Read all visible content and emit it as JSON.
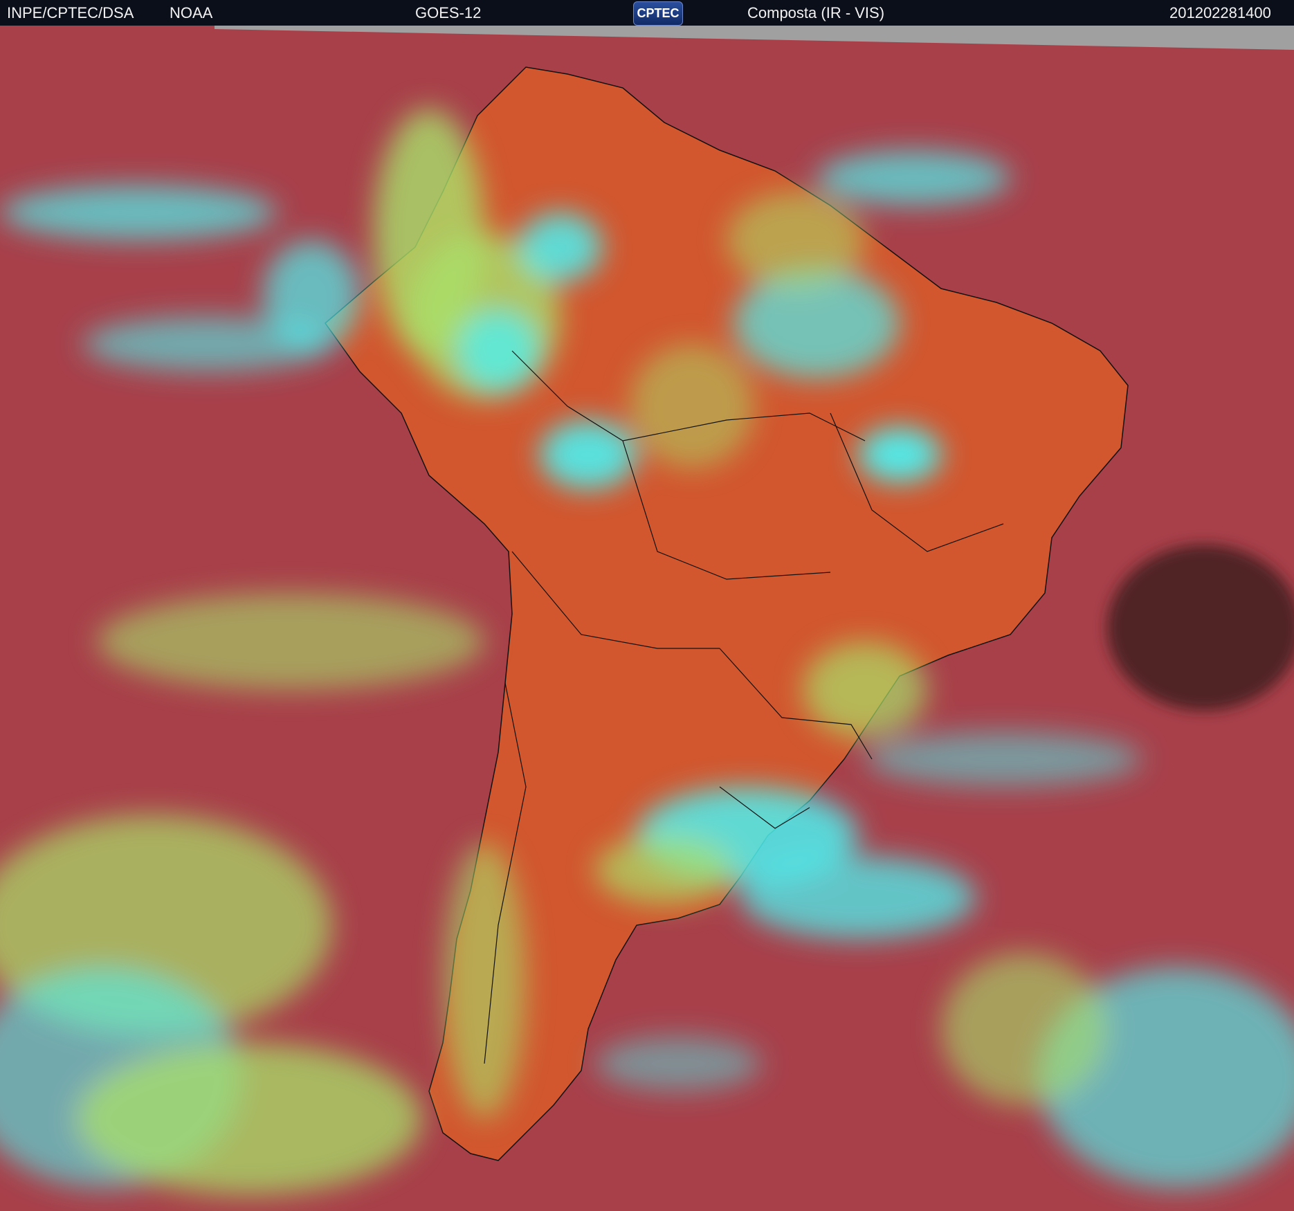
{
  "header": {
    "agency": "INPE/CPTEC/DSA",
    "source": "NOAA",
    "satellite": "GOES-12",
    "logo_text": "CPTEC",
    "product": "Composta (IR - VIS)",
    "timestamp": "201202281400"
  },
  "colors": {
    "header_bg": "#0b0f1a",
    "ocean_clear": "#a8404a",
    "land_clear": "#d2572f",
    "low_cloud": "#a9e06a",
    "high_cloud": "#4ef0f0",
    "borders": "#000000"
  }
}
